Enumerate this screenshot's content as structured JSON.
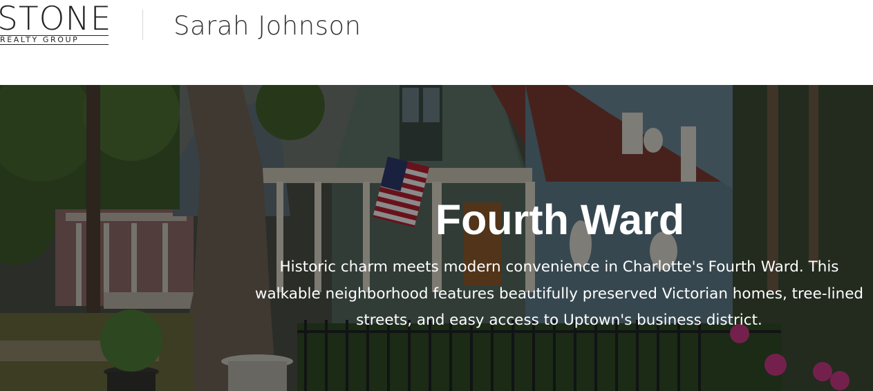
{
  "header": {
    "logo": {
      "wordmark": "STONE",
      "tagline": "REALTY GROUP"
    },
    "agent_name": "Sarah Johnson"
  },
  "hero": {
    "title": "Fourth Ward",
    "description": "Historic charm meets modern convenience in Charlotte's Fourth Ward. This walkable neighborhood features beautifully preserved Victorian homes, tree-lined streets, and easy access to Uptown's business district."
  },
  "colors": {
    "header_bg": "#ffffff",
    "text_dark": "#333333",
    "hero_text": "#ffffff",
    "overlay": "rgba(0,0,0,0.45)"
  }
}
